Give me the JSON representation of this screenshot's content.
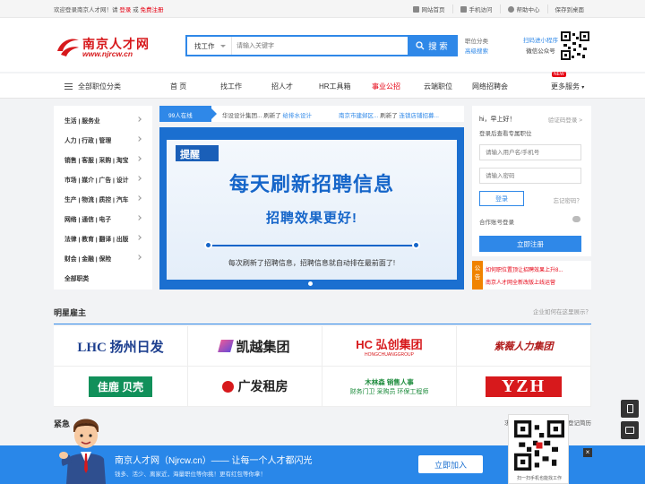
{
  "topbar": {
    "welcome_prefix": "欢迎登录南京人才网！请",
    "login": "登录",
    "or": "或",
    "register": "免费注册",
    "links": [
      "网站首页",
      "手机访问",
      "帮助中心",
      "保存到桌面"
    ]
  },
  "logo": {
    "cn": "南京人才网",
    "en": "www.njrcw.cn"
  },
  "search": {
    "type": "找工作",
    "placeholder": "请输入关键字",
    "button": "搜 索"
  },
  "header_links": [
    "职位分类",
    "高级搜索"
  ],
  "miniprogram": {
    "line1": "扫码进小程序",
    "line2": "微信公众号"
  },
  "nav": {
    "all": "全部职位分类",
    "items": [
      "首 页",
      "找工作",
      "招人才",
      "HR工具箱",
      "事业公招",
      "云端职位",
      "网络招聘会",
      "更多服务"
    ],
    "new_badge": "NEW"
  },
  "categories": [
    "生活 | 服务业",
    "人力 | 行政 | 管理",
    "销售 | 客服 | 采购 | 淘宝",
    "市场 | 媒介 | 广告 | 设计",
    "生产 | 物流 | 质控 | 汽车",
    "网络 | 通信 | 电子",
    "法律 | 教育 | 翻译 | 出版",
    "财会 | 金融 | 保险",
    "全部职类"
  ],
  "ticker": {
    "online": "99人在线",
    "news": [
      {
        "company": "华设设计集团...",
        "action": "刷新了",
        "job": "给排水设计"
      },
      {
        "company": "南京市建邺区...",
        "action": "刷新了",
        "job": "连锁店铺招募..."
      }
    ]
  },
  "banner": {
    "tag": "提醒",
    "headline": "每天刷新招聘信息",
    "subline": "招聘效果更好!",
    "footer": "每次刷新了招聘信息，招聘信息就自动排在最前面了!"
  },
  "login": {
    "greeting": "hi，早上好！",
    "code_login": "验证码登录 >",
    "subtitle": "登录后查看专属职位",
    "username_placeholder": "请输入用户名/手机号",
    "password_placeholder": "请输入密码",
    "login_button": "登录",
    "forgot": "忘记密码？",
    "combo": "合作账号登录",
    "register_button": "立即注册"
  },
  "announcement": {
    "tag": "公告",
    "lines": [
      "如何职位置顶让招聘效果上升8...",
      "南京人才网全新改版上线运营"
    ]
  },
  "employers": {
    "title": "明星雇主",
    "right": "企业如何在这里展示？",
    "logos": [
      "LHC 扬州日发",
      "凯越集团",
      "HC 弘创集团",
      "紫薇人力集团",
      "佳鹿 贝壳",
      "广发租房",
      "木林森 销售人事",
      "YZH"
    ],
    "logo_sublines": [
      "HONGCHUANGGROUP",
      "财务门卫 采购员 环保工程师"
    ]
  },
  "urgent": {
    "title": "紧急",
    "right_prefix": "求职",
    "right_suffix": "登记简历"
  },
  "bottombar": {
    "title": "南京人才网（Njrcw.cn）—— 让每一个人才都闪光",
    "subtitle": "钱多、活少、离家近，海量职位等你挑！更有红包等你拿！",
    "join": "立即加入",
    "close": "×"
  },
  "qr_popup": {
    "caption": "扫一扫手机也能找工作"
  },
  "colors": {
    "accent": "#2f88e8",
    "brand_red": "#e60012",
    "banner_blue": "#1565c9"
  }
}
